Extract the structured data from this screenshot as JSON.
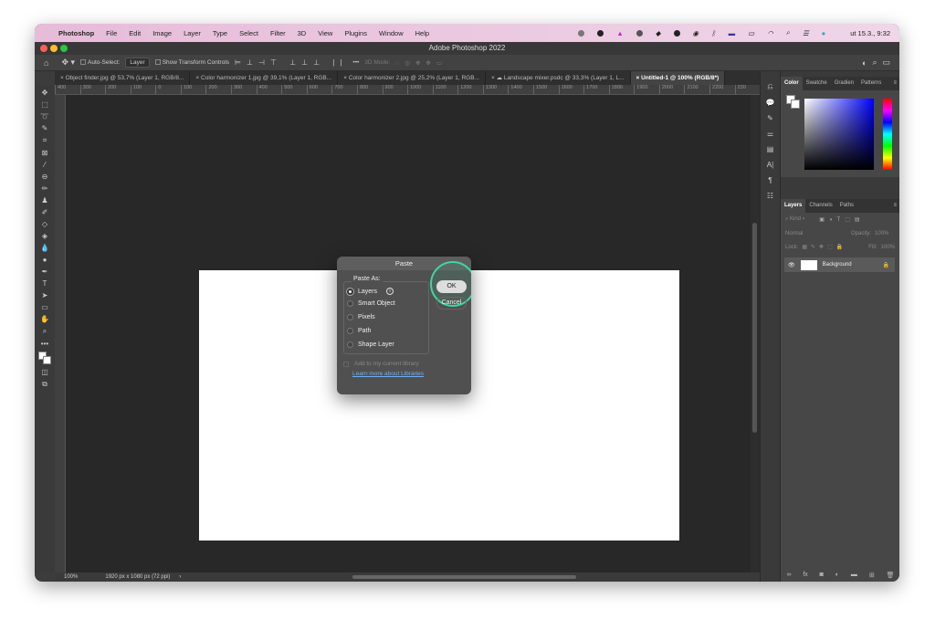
{
  "menubar": {
    "apple": "",
    "app": "Photoshop",
    "items": [
      "File",
      "Edit",
      "Image",
      "Layer",
      "Type",
      "Select",
      "Filter",
      "3D",
      "View",
      "Plugins",
      "Window",
      "Help"
    ],
    "clock": "ut 15.3., 9:32"
  },
  "window": {
    "title": "Adobe Photoshop 2022"
  },
  "options": {
    "auto_select": "Auto-Select:",
    "auto_select_value": "Layer",
    "show_transform": "Show Transform Controls",
    "more": "•••",
    "mode_3d": "3D Mode:"
  },
  "tabs": [
    {
      "label": "Object finder.jpg @ 53,7% (Layer 1, RGB/8..."
    },
    {
      "label": "Color harmonizer 1.jpg @ 39,1% (Layer 1, RGB..."
    },
    {
      "label": "Color harmonizer 2.jpg @ 25,2% (Layer 1, RGB..."
    },
    {
      "label": "Landscape mixer.psdc @ 33,3% (Layer 1, L..."
    },
    {
      "label": "Untitled-1 @ 100% (RGB/8*)",
      "active": true
    }
  ],
  "ruler_ticks": [
    "400",
    "300",
    "200",
    "100",
    "0",
    "100",
    "200",
    "300",
    "400",
    "500",
    "600",
    "700",
    "800",
    "900",
    "1000",
    "1100",
    "1200",
    "1300",
    "1400",
    "1500",
    "1600",
    "1700",
    "1800",
    "1900",
    "2000",
    "2100",
    "2200",
    "230"
  ],
  "status": {
    "zoom": "100%",
    "doc_size": "1920 px x 1080 px (72 ppi)",
    "arrow": "›"
  },
  "color_panel": {
    "tabs": [
      "Color",
      "Swatche",
      "Gradien",
      "Patterns"
    ],
    "foreground": "#ffffff",
    "hue": "#0000ff"
  },
  "layers_panel": {
    "tabs": [
      "Layers",
      "Channels",
      "Paths"
    ],
    "kind": "Kind",
    "blend": "Normal",
    "opacity_label": "Opacity:",
    "opacity": "100%",
    "lock_label": "Lock:",
    "fill_label": "Fill:",
    "fill": "100%",
    "layers": [
      {
        "name": "Background",
        "locked": true
      }
    ]
  },
  "dialog": {
    "title": "Paste",
    "group_label": "Paste As:",
    "options": [
      "Layers",
      "Smart Object",
      "Pixels",
      "Path",
      "Shape Layer"
    ],
    "selected": "Layers",
    "ok": "OK",
    "cancel": "Cancel",
    "add_library": "Add to my current library",
    "learn_more": "Learn more about Libraries"
  },
  "colors": {
    "accent_ring": "#3fd6a0",
    "link": "#6ab0ff"
  }
}
